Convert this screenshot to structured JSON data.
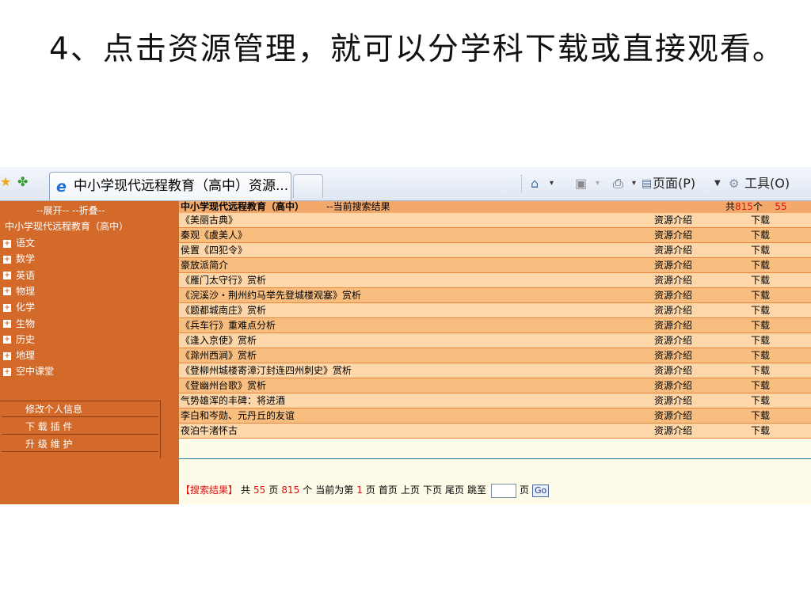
{
  "slide": {
    "heading": "4、点击资源管理，就可以分学科下载或直接观看。"
  },
  "browser": {
    "tab_title": "中小学现代远程教育（高中）资源...",
    "icons": [
      "favorites-star-icon",
      "add-favorite-icon",
      "ie-page-icon",
      "home-icon",
      "feed-icon",
      "print-icon",
      "page-icon",
      "tools-gear-icon"
    ],
    "page_menu": "页面(P)",
    "tools_menu": "工具(O)"
  },
  "sidebar": {
    "toggle_text": "--展开-- --折叠--",
    "site_title": "中小学现代远程教育（高中）",
    "subjects": [
      "语文",
      "数学",
      "英语",
      "物理",
      "化学",
      "生物",
      "历史",
      "地理",
      "空中课堂"
    ],
    "links": [
      "修改个人信息",
      "下 载 插 件",
      "升 级 维 护"
    ]
  },
  "list": {
    "title": "中小学现代远程教育（高中）",
    "subtitle": "--当前搜索结果",
    "total_prefix": "共",
    "total_count": "815",
    "total_suffix": "个",
    "total_pages": "55",
    "intro_label": "资源介绍",
    "download_label": "下载",
    "rows": [
      "《美丽古典》",
      "秦观《虞美人》",
      "侯置《四犯令》",
      "豪放派简介",
      "《雁门太守行》赏析",
      "《浣溪沙・荆州约马举先登城楼观塞》赏析",
      "《题都城南庄》赏析",
      "《兵车行》重难点分析",
      "《逢入京使》赏析",
      "《滁州西涧》赏析",
      "《登柳州城楼寄漳汀封连四州刺史》赏析",
      "《登幽州台歌》赏析",
      "气势雄浑的丰碑：将进酒",
      "李白和岑勋、元丹丘的友谊",
      "夜泊牛渚怀古"
    ]
  },
  "pager": {
    "label": "【搜索结果】",
    "total_text": "共",
    "pages": "55",
    "pages_unit": "页",
    "items": "815",
    "items_unit": "个",
    "current_text": "当前为第",
    "current": "1",
    "current_unit": "页",
    "first": "首页",
    "prev": "上页",
    "next": "下页",
    "last": "尾页",
    "jump": "跳至",
    "jump_unit": "页",
    "go": "Go"
  }
}
